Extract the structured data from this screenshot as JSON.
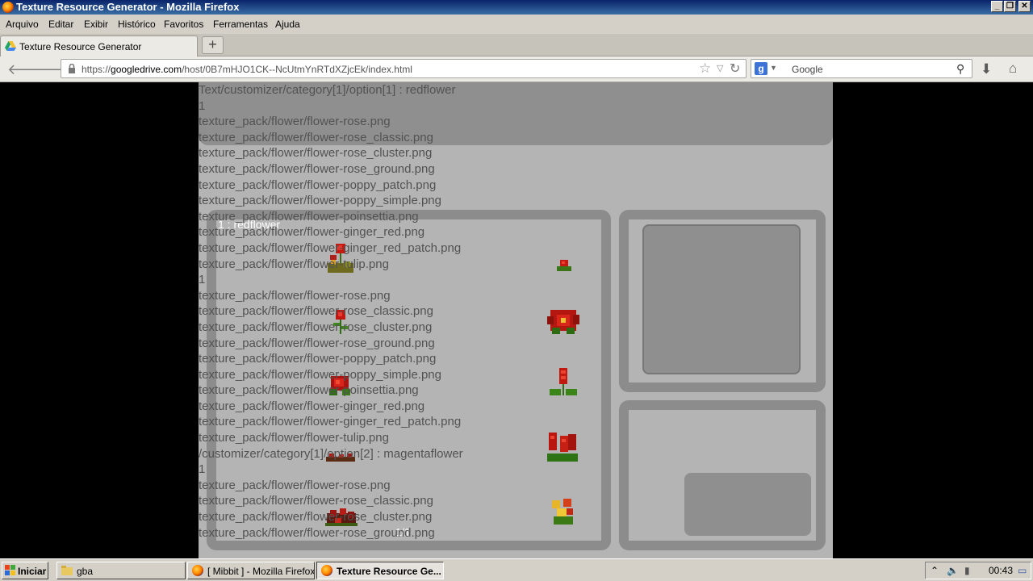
{
  "window": {
    "title": "Texture Resource Generator - Mozilla Firefox",
    "controls": {
      "minimize": "_",
      "restore": "❐",
      "close": "✕"
    }
  },
  "menu": [
    "Arquivo",
    "Editar",
    "Exibir",
    "Histórico",
    "Favoritos",
    "Ferramentas",
    "Ajuda"
  ],
  "tabs": [
    {
      "label": "Texture Resource Generator",
      "active": true
    }
  ],
  "new_tab_label": "+",
  "nav": {
    "back": "🡐",
    "forward": "🡒",
    "url_prefix": "https://",
    "url_host": "googledrive.com",
    "url_path": "/host/0B7mHJO1CK--NcUtmYnRTdXZjcEk/index.html",
    "search_engine": "g",
    "search_placeholder": "Google"
  },
  "app": {
    "panel_title": "1 : redflower",
    "page_indicator": "1/1",
    "colors": {
      "background": "#b4b4b4",
      "panel_border": "#8c8c8c",
      "overlay_text": "#525252"
    },
    "sprites_left": [
      {
        "name": "rose",
        "kind": "rose-single"
      },
      {
        "name": "rose_classic",
        "kind": "rose-small"
      },
      {
        "name": "rose_cluster",
        "kind": "rose-bloom"
      },
      {
        "name": "rose_ground",
        "kind": "ground-low"
      },
      {
        "name": "poppy_patch",
        "kind": "patch-dark"
      }
    ],
    "sprites_right": [
      {
        "name": "poppy_simple",
        "kind": "tiny"
      },
      {
        "name": "poinsettia",
        "kind": "poinsettia"
      },
      {
        "name": "ginger_red",
        "kind": "ginger"
      },
      {
        "name": "ginger_red_patch",
        "kind": "ginger-patch"
      },
      {
        "name": "tulip",
        "kind": "tulip-mix"
      }
    ]
  },
  "overlay_lines": [
    "Text/customizer/category[1]/option[1] : redflower",
    "1",
    "texture_pack/flower/flower-rose.png",
    "texture_pack/flower/flower-rose_classic.png",
    "texture_pack/flower/flower-rose_cluster.png",
    "texture_pack/flower/flower-rose_ground.png",
    "texture_pack/flower/flower-poppy_patch.png",
    "texture_pack/flower/flower-poppy_simple.png",
    "texture_pack/flower/flower-poinsettia.png",
    "texture_pack/flower/flower-ginger_red.png",
    "texture_pack/flower/flower-ginger_red_patch.png",
    "texture_pack/flower/flower-tulip.png",
    "1",
    "texture_pack/flower/flower-rose.png",
    "texture_pack/flower/flower-rose_classic.png",
    "texture_pack/flower/flower-rose_cluster.png",
    "texture_pack/flower/flower-rose_ground.png",
    "texture_pack/flower/flower-poppy_patch.png",
    "texture_pack/flower/flower-poppy_simple.png",
    "texture_pack/flower/flower-poinsettia.png",
    "texture_pack/flower/flower-ginger_red.png",
    "texture_pack/flower/flower-ginger_red_patch.png",
    "texture_pack/flower/flower-tulip.png",
    "/customizer/category[1]/option[2] : magentaflower",
    "1",
    "texture_pack/flower/flower-rose.png",
    "texture_pack/flower/flower-rose_classic.png",
    "texture_pack/flower/flower-rose_cluster.png",
    "texture_pack/flower/flower-rose_ground.png"
  ],
  "taskbar": {
    "start_label": "Iniciar",
    "items": [
      {
        "label": "gba",
        "icon": "folder-icon",
        "active": false
      },
      {
        "label": "[ Mibbit ] - Mozilla Firefox",
        "icon": "firefox-icon",
        "active": false
      },
      {
        "label": "Texture Resource Ge...",
        "icon": "firefox-icon",
        "active": true
      }
    ],
    "clock": "00:43"
  }
}
